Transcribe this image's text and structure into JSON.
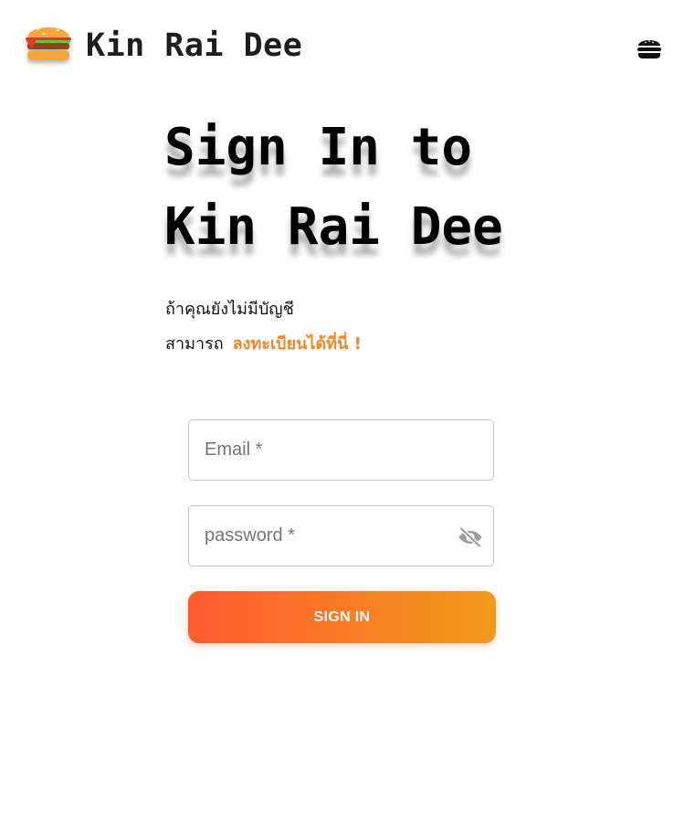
{
  "header": {
    "logo_icon": "burger-logo-icon",
    "brand_name": "Kin Rai Dee",
    "menu_icon": "burger-menu-icon"
  },
  "heading": {
    "line1": "Sign In to",
    "line2": "Kin Rai Dee"
  },
  "intro": {
    "line1": "ถ้าคุณยังไม่มีบัญชี",
    "line2_prefix": "สามารถ",
    "register_link": "ลงทะเบียนได้ที่นี่ !"
  },
  "form": {
    "email_placeholder": "Email *",
    "email_value": "",
    "password_placeholder": "password *",
    "password_value": "",
    "visibility_icon": "eye-off-icon",
    "submit_label": "SIGN IN"
  },
  "colors": {
    "accent": "#f0882a",
    "button_gradient_start": "#ff5a30",
    "button_gradient_end": "#f29a1a"
  }
}
